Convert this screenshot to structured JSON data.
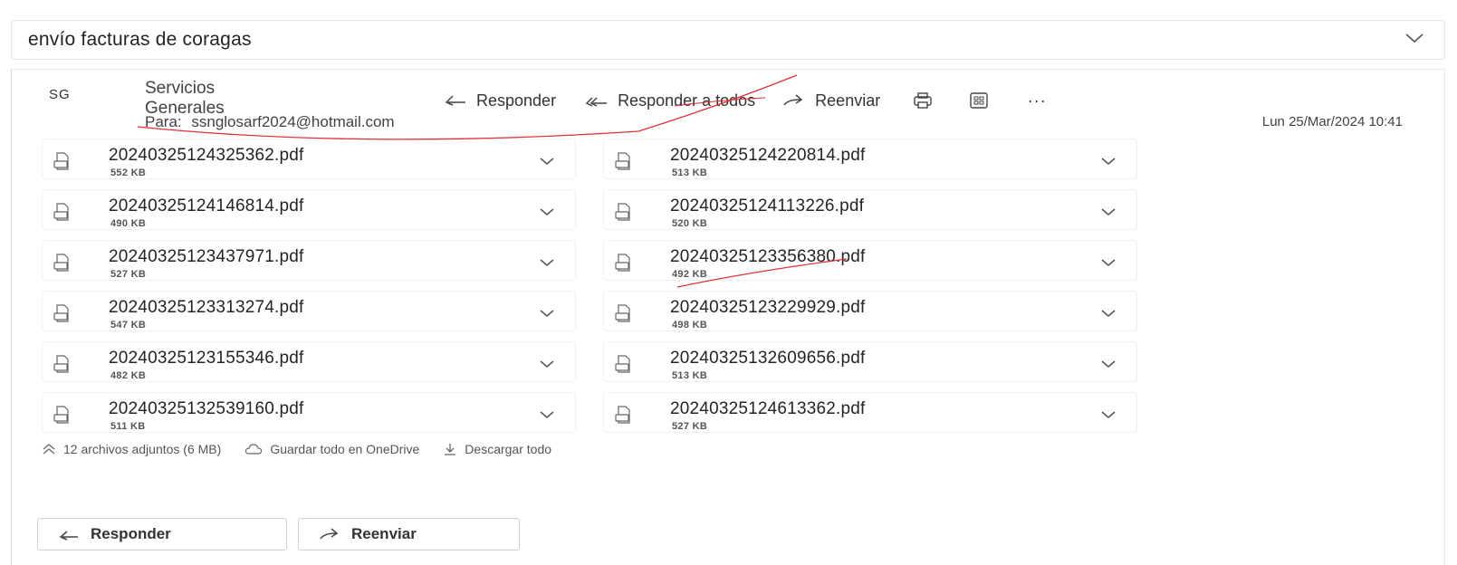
{
  "subject": "envío facturas de coragas",
  "icons": {
    "expand": "chevron-down-icon",
    "reply": "reply-arrow-icon",
    "reply_all": "reply-all-arrows-icon",
    "forward": "forward-arrow-icon",
    "print": "print-icon",
    "view": "immersive-reader-icon",
    "more": "more-ellipsis-icon",
    "file": "file-icon",
    "collapse": "chevron-up-double-icon",
    "cloud": "cloud-icon",
    "download": "download-icon"
  },
  "message": {
    "avatar_initials": "SG",
    "sender": "Servicios Generales",
    "to_label": "Para:",
    "to_address": "ssnglosarf2024@hotmail.com",
    "date": "Lun 25/Mar/2024 10:41"
  },
  "toolbar": {
    "reply": "Responder",
    "reply_all": "Responder a todos",
    "forward": "Reenviar",
    "more": "···"
  },
  "attachments": [
    {
      "name": "20240325124325362.pdf",
      "size": "552 KB"
    },
    {
      "name": "20240325124220814.pdf",
      "size": "513 KB"
    },
    {
      "name": "20240325124146814.pdf",
      "size": "490 KB"
    },
    {
      "name": "20240325124113226.pdf",
      "size": "520 KB"
    },
    {
      "name": "20240325123437971.pdf",
      "size": "527 KB"
    },
    {
      "name": "20240325123356380.pdf",
      "size": "492 KB"
    },
    {
      "name": "20240325123313274.pdf",
      "size": "547 KB"
    },
    {
      "name": "20240325123229929.pdf",
      "size": "498 KB"
    },
    {
      "name": "20240325123155346.pdf",
      "size": "482 KB"
    },
    {
      "name": "20240325132609656.pdf",
      "size": "513 KB"
    },
    {
      "name": "20240325132539160.pdf",
      "size": "511 KB"
    },
    {
      "name": "20240325124613362.pdf",
      "size": "527 KB"
    }
  ],
  "attachments_summary": {
    "count_text": "12 archivos adjuntos (6 MB)",
    "save_onedrive": "Guardar todo en OneDrive",
    "download_all": "Descargar todo"
  },
  "footer_buttons": {
    "reply": "Responder",
    "forward": "Reenviar"
  },
  "colors": {
    "annotation_red": "#e0303a",
    "border": "#e6e6e6",
    "text": "#242424"
  }
}
